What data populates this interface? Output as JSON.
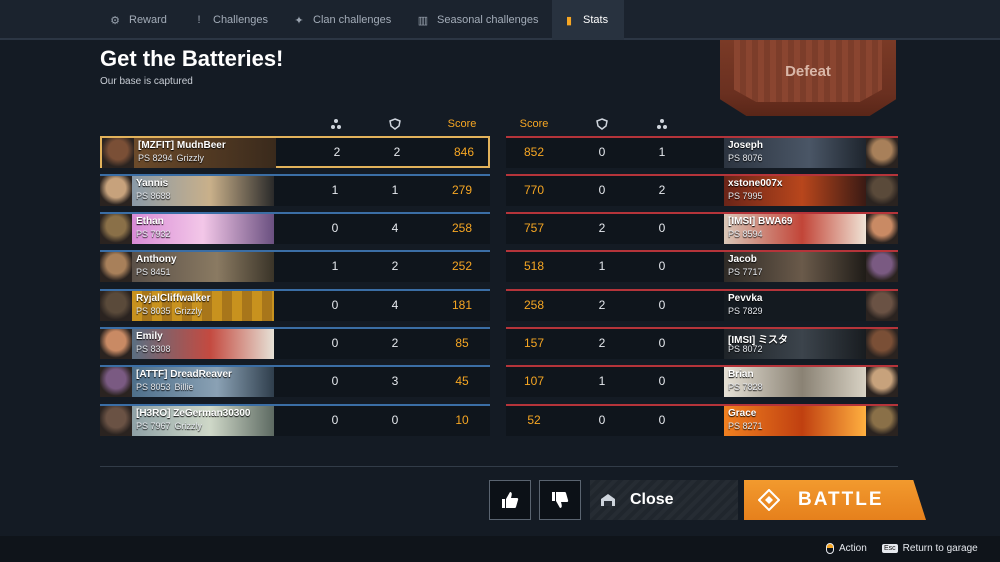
{
  "tabs": [
    {
      "label": "Reward",
      "icon": "reward-icon",
      "glyph": "⚙"
    },
    {
      "label": "Challenges",
      "icon": "challenges-icon",
      "glyph": "!"
    },
    {
      "label": "Clan challenges",
      "icon": "clan-challenges-icon",
      "glyph": "✦"
    },
    {
      "label": "Seasonal challenges",
      "icon": "seasonal-challenges-icon",
      "glyph": "▥"
    },
    {
      "label": "Stats",
      "icon": "stats-icon",
      "glyph": "▮",
      "active": true
    }
  ],
  "header": {
    "title": "Get the Batteries!",
    "subtitle": "Our base is captured",
    "result": "Defeat"
  },
  "columns": {
    "kills_icon": "kills-icon",
    "assists_icon": "shield-icon",
    "score": "Score"
  },
  "left_team": [
    {
      "name": "[MZFIT] MudnBeer",
      "ps": "PS 8294",
      "clan": "Grizzly",
      "kills": "2",
      "assists": "2",
      "score": "846",
      "me": true
    },
    {
      "name": "Yannis",
      "ps": "PS 8688",
      "clan": "",
      "kills": "1",
      "assists": "1",
      "score": "279"
    },
    {
      "name": "Ethan",
      "ps": "PS 7932",
      "clan": "",
      "kills": "0",
      "assists": "4",
      "score": "258"
    },
    {
      "name": "Anthony",
      "ps": "PS 8451",
      "clan": "",
      "kills": "1",
      "assists": "2",
      "score": "252"
    },
    {
      "name": "RyjalCliffwalker",
      "ps": "PS 8035",
      "clan": "Grizzly",
      "kills": "0",
      "assists": "4",
      "score": "181"
    },
    {
      "name": "Emily",
      "ps": "PS 8308",
      "clan": "",
      "kills": "0",
      "assists": "2",
      "score": "85"
    },
    {
      "name": "[ATTF] DreadReaver",
      "ps": "PS 8053",
      "clan": "Billie",
      "kills": "0",
      "assists": "3",
      "score": "45"
    },
    {
      "name": "[H3RO] ZeGerman30300",
      "ps": "PS 7967",
      "clan": "Grizzly",
      "kills": "0",
      "assists": "0",
      "score": "10"
    }
  ],
  "right_team": [
    {
      "name": "Joseph",
      "ps": "PS 8076",
      "kills": "1",
      "assists": "0",
      "score": "852"
    },
    {
      "name": "xstone007x",
      "ps": "PS 7995",
      "kills": "2",
      "assists": "0",
      "score": "770"
    },
    {
      "name": "[IMSI] BWA69",
      "ps": "PS 8594",
      "kills": "0",
      "assists": "2",
      "score": "757"
    },
    {
      "name": "Jacob",
      "ps": "PS 7717",
      "kills": "0",
      "assists": "1",
      "score": "518"
    },
    {
      "name": "Pevvka",
      "ps": "PS 7829",
      "kills": "0",
      "assists": "2",
      "score": "258"
    },
    {
      "name": "[IMSI] ミスタ",
      "ps": "PS 8072",
      "kills": "0",
      "assists": "2",
      "score": "157"
    },
    {
      "name": "Brian",
      "ps": "PS 7828",
      "kills": "0",
      "assists": "1",
      "score": "107"
    },
    {
      "name": "Grace",
      "ps": "PS 8271",
      "kills": "0",
      "assists": "0",
      "score": "52"
    }
  ],
  "buttons": {
    "like_icon": "thumbs-up-icon",
    "dislike_icon": "thumbs-down-icon",
    "close": "Close",
    "battle": "BATTLE"
  },
  "footer": {
    "action": "Action",
    "esc_key": "Esc",
    "return": "Return to garage"
  },
  "colors": {
    "accent": "#f6a623",
    "ally": "#3b6ea5",
    "enemy": "#b5343a",
    "me_border": "#e2b25b",
    "defeat_banner": "#7a3a26"
  }
}
